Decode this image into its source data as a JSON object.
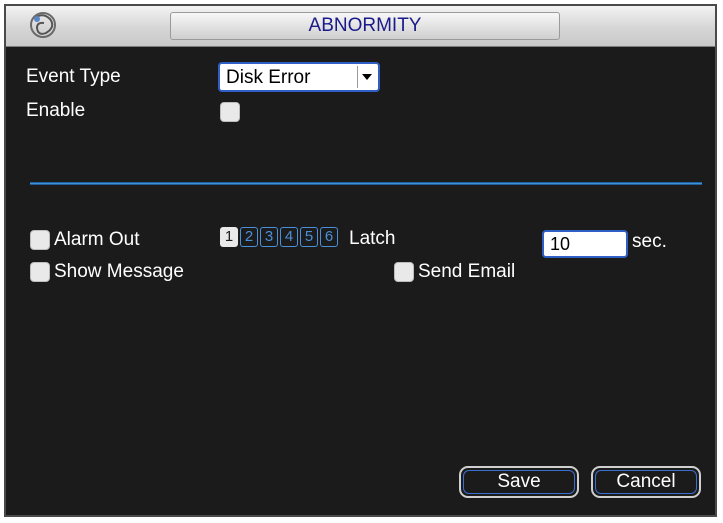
{
  "window": {
    "title": "ABNORMITY"
  },
  "form": {
    "event_type_label": "Event Type",
    "event_type_value": "Disk Error",
    "enable_label": "Enable",
    "alarm_out_label": "Alarm Out",
    "channels": [
      "1",
      "2",
      "3",
      "4",
      "5",
      "6"
    ],
    "selected_channel": "1",
    "latch_label": "Latch",
    "latch_value": "10",
    "latch_unit": "sec.",
    "show_message_label": "Show Message",
    "send_email_label": "Send Email"
  },
  "buttons": {
    "save": "Save",
    "cancel": "Cancel"
  },
  "colors": {
    "background": "#1b1b1b",
    "accent": "#2f5fc4",
    "title_text": "#1a1a8a"
  },
  "icons": {
    "title_logo": "spiral-logo-icon",
    "dropdown": "chevron-down-icon"
  }
}
